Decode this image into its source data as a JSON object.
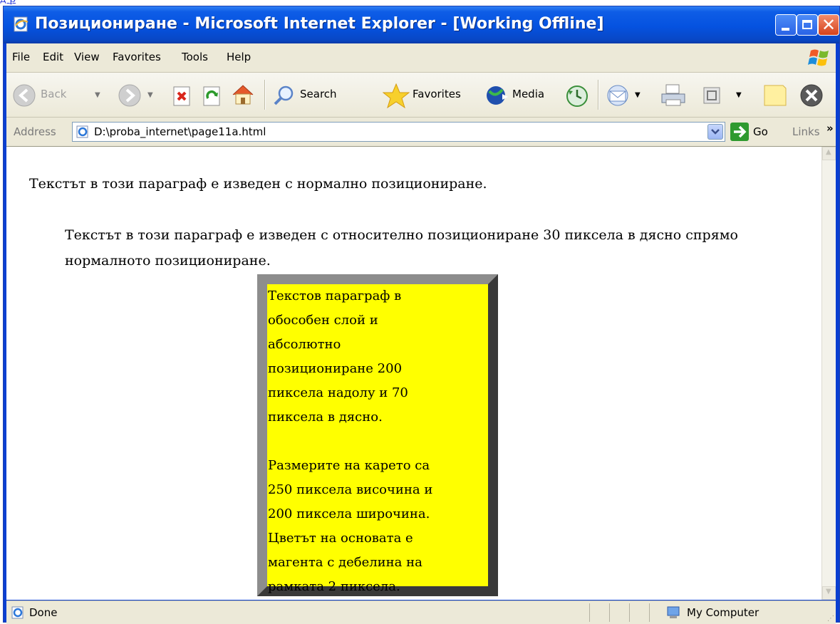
{
  "title_bar": {
    "title": "Позициониране - Microsoft Internet Explorer - [Working Offline]"
  },
  "menu": {
    "items": [
      "File",
      "Edit",
      "View",
      "Favorites",
      "Tools",
      "Help"
    ]
  },
  "toolbar": {
    "back_label": "Back",
    "search_label": "Search",
    "favorites_label": "Favorites",
    "media_label": "Media"
  },
  "address_bar": {
    "label": "Address",
    "url": "D:\\proba_internet\\page11a.html",
    "go_label": "Go",
    "links_label": "Links",
    "more_glyph": "»"
  },
  "content": {
    "p_normal": "Текстът в този параграф е изведен с нормално позициониране.",
    "p_relative": "Текстът в този параграф е изведен с относително позициониране 30 пиксела в дясно спрямо нормалното позициониране.",
    "box_lines_1": [
      "Текстов параграф в",
      "обособен слой и",
      "абсолютно",
      "позициониране 200",
      "пиксела надолу и 70",
      "пиксела в дясно."
    ],
    "box_lines_2": [
      "Размерите на карето са",
      "250 пиксела височина и",
      "200 пиксела широчина.",
      "Цветът на основата е",
      "магента с дебелина на",
      "рамката 2 пиксела."
    ]
  },
  "status_bar": {
    "status": "Done",
    "zone": "My Computer"
  },
  "colors": {
    "titlebar": "#0552e0",
    "box_background": "#ffff00",
    "box_border": "#8d8d8d",
    "chrome": "#ece9d8"
  }
}
